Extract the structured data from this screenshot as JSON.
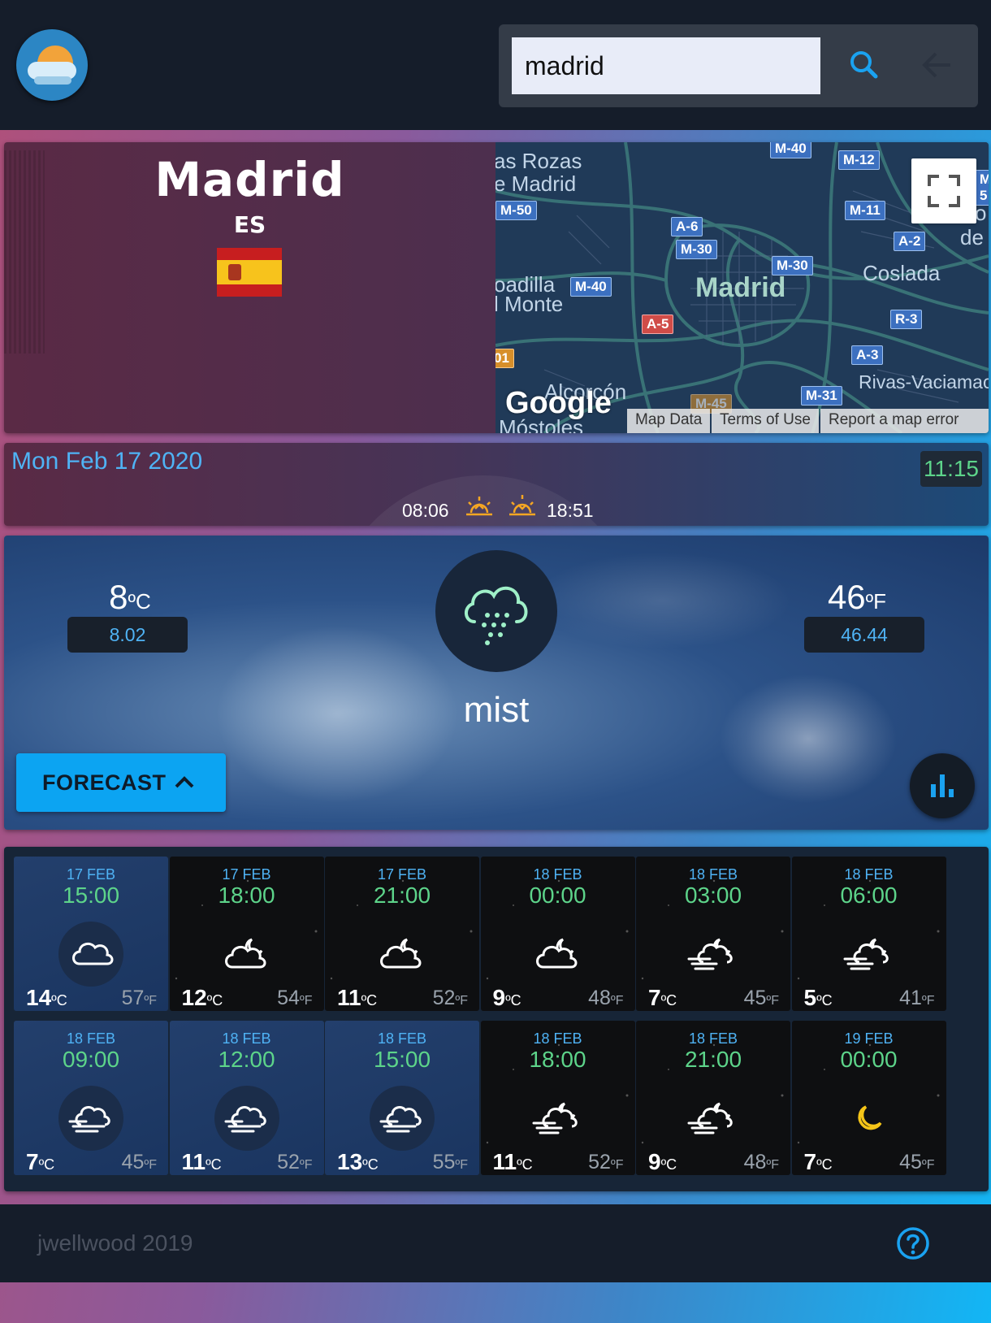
{
  "header": {
    "logo_icon": "weather-logo-icon",
    "search_value": "madrid",
    "search_icon": "search-icon",
    "back_icon": "arrow-left-icon"
  },
  "location": {
    "city": "Madrid",
    "country": "ES",
    "flag": "spain-flag"
  },
  "map": {
    "labels": [
      "as Rozas",
      "e Madrid",
      "oadilla",
      "l Monte",
      "Coslada",
      "o",
      "de",
      "Alcorcón",
      "Rivas-Vaciamac",
      "Móstoles"
    ],
    "city_label": "Madrid",
    "shields": [
      "M-40",
      "M-12",
      "M-5",
      "M-50",
      "A-6",
      "M-11",
      "M-30",
      "A-2",
      "M-30",
      "M-40",
      "A-5",
      "R-3",
      "A-3",
      "01",
      "M-31",
      "M-45"
    ],
    "brand": "Google",
    "footer": {
      "map_data": "Map Data",
      "terms": "Terms of Use",
      "report": "Report a map error"
    }
  },
  "datebar": {
    "date": "Mon Feb 17 2020",
    "time": "11:15",
    "sunrise": "08:06",
    "sunset": "18:51"
  },
  "current": {
    "temp_c": "8",
    "unit_c": "ºC",
    "exact_c": "8.02",
    "temp_f": "46",
    "unit_f": "ºF",
    "exact_f": "46.44",
    "icon": "cloud-rain-icon",
    "description": "mist",
    "forecast_label": "FORECAST",
    "chart_icon": "bar-chart-icon"
  },
  "forecast": [
    {
      "date": "17  FEB",
      "time": "15:00",
      "icon": "cloud-icon",
      "c": "14",
      "f": "57",
      "theme": "day"
    },
    {
      "date": "17  FEB",
      "time": "18:00",
      "icon": "cloud-moon-icon",
      "c": "12",
      "f": "54",
      "theme": "night"
    },
    {
      "date": "17  FEB",
      "time": "21:00",
      "icon": "cloud-moon-icon",
      "c": "11",
      "f": "52",
      "theme": "night"
    },
    {
      "date": "18  FEB",
      "time": "00:00",
      "icon": "cloud-moon-icon",
      "c": "9",
      "f": "48",
      "theme": "night"
    },
    {
      "date": "18  FEB",
      "time": "03:00",
      "icon": "windy-cloud-moon-icon",
      "c": "7",
      "f": "45",
      "theme": "night"
    },
    {
      "date": "18  FEB",
      "time": "06:00",
      "icon": "windy-cloud-moon-icon",
      "c": "5",
      "f": "41",
      "theme": "night"
    },
    {
      "date": "18  FEB",
      "time": "09:00",
      "icon": "windy-cloud-icon",
      "c": "7",
      "f": "45",
      "theme": "day"
    },
    {
      "date": "18  FEB",
      "time": "12:00",
      "icon": "windy-cloud-icon",
      "c": "11",
      "f": "52",
      "theme": "day"
    },
    {
      "date": "18  FEB",
      "time": "15:00",
      "icon": "windy-cloud-icon",
      "c": "13",
      "f": "55",
      "theme": "day"
    },
    {
      "date": "18  FEB",
      "time": "18:00",
      "icon": "windy-cloud-moon-icon",
      "c": "11",
      "f": "52",
      "theme": "night"
    },
    {
      "date": "18  FEB",
      "time": "21:00",
      "icon": "windy-cloud-moon-icon",
      "c": "9",
      "f": "48",
      "theme": "night"
    },
    {
      "date": "19  FEB",
      "time": "00:00",
      "icon": "moon-icon",
      "c": "7",
      "f": "45",
      "theme": "night"
    }
  ],
  "footer": {
    "credit": "jwellwood 2019",
    "help_icon": "help-circle-icon"
  },
  "colors": {
    "accent_blue": "#4fb3f5",
    "time_green": "#5dd48a",
    "button_blue": "#0ca4f2",
    "header_bg": "#151d2a"
  }
}
